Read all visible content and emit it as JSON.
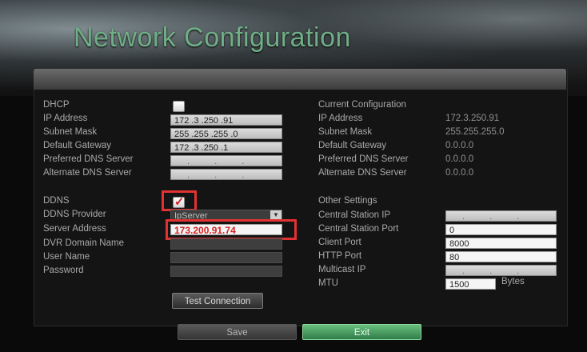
{
  "header": {
    "title": "Network Configuration"
  },
  "left": {
    "dhcp_label": "DHCP",
    "ip_label": "IP Address",
    "ip_value": "172 .3    .250 .91",
    "subnet_label": "Subnet Mask",
    "subnet_value": "255 .255 .255 .0",
    "gateway_label": "Default Gateway",
    "gateway_value": "172 .3    .250 .1",
    "pref_dns_label": "Preferred DNS Server",
    "pref_dns_value": ". . .",
    "alt_dns_label": "Alternate DNS Server",
    "alt_dns_value": ". . .",
    "ddns_label": "DDNS",
    "ddns_provider_label": "DDNS Provider",
    "ddns_provider_value": "IpServer",
    "server_address_label": "Server Address",
    "server_address_value": "173.200.91.74",
    "dvr_domain_label": "DVR Domain Name",
    "user_name_label": "User Name",
    "password_label": "Password",
    "test_button": "Test Connection"
  },
  "right": {
    "current_config_label": "Current Configuration",
    "ip_label": "IP Address",
    "ip_value": "172.3.250.91",
    "subnet_label": "Subnet Mask",
    "subnet_value": "255.255.255.0",
    "gateway_label": "Default Gateway",
    "gateway_value": "0.0.0.0",
    "pref_dns_label": "Preferred DNS Server",
    "pref_dns_value": "0.0.0.0",
    "alt_dns_label": "Alternate DNS Server",
    "alt_dns_value": "0.0.0.0",
    "other_settings_label": "Other Settings",
    "central_ip_label": "Central Station IP",
    "central_ip_value": ". . .",
    "central_port_label": "Central Station Port",
    "central_port_value": "0",
    "client_port_label": "Client Port",
    "client_port_value": "8000",
    "http_port_label": "HTTP Port",
    "http_port_value": "80",
    "multicast_label": "Multicast IP",
    "multicast_value": ". . .",
    "mtu_label": "MTU",
    "mtu_value": "1500",
    "mtu_unit": "Bytes"
  },
  "footer": {
    "save_label": "Save",
    "exit_label": "Exit"
  },
  "colors": {
    "title": "#6fae86",
    "highlight": "#e23232",
    "exit": "#3f9a5c"
  }
}
